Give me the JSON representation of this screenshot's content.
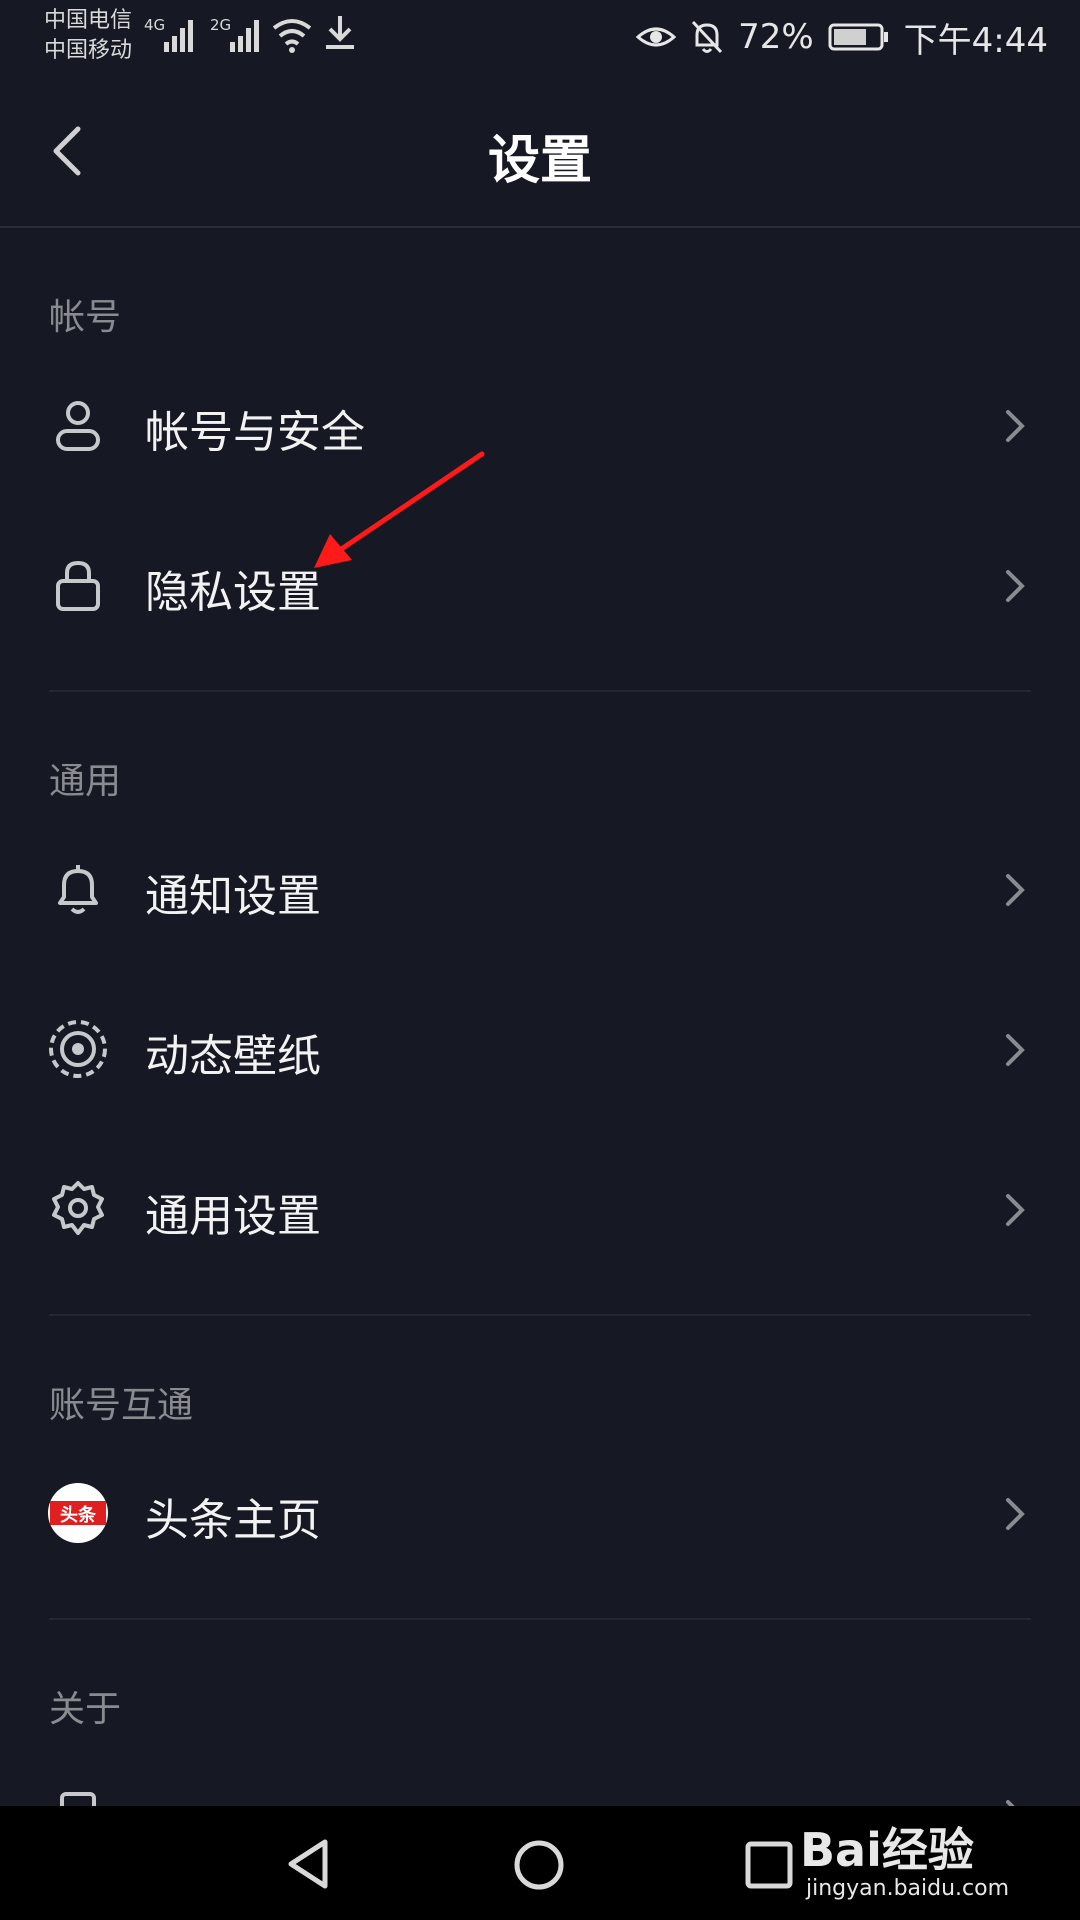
{
  "status_bar": {
    "carrier1": "中国电信",
    "carrier2": "中国移动",
    "net1": "4G",
    "net2": "2G",
    "battery": "72%",
    "time": "下午4:44"
  },
  "header": {
    "title": "设置"
  },
  "sections": {
    "account": {
      "label": "帐号",
      "items": [
        {
          "label": "帐号与安全",
          "icon": "person-icon"
        },
        {
          "label": "隐私设置",
          "icon": "lock-icon"
        }
      ]
    },
    "general": {
      "label": "通用",
      "items": [
        {
          "label": "通知设置",
          "icon": "bell-icon"
        },
        {
          "label": "动态壁纸",
          "icon": "wallpaper-icon"
        },
        {
          "label": "通用设置",
          "icon": "gear-icon"
        }
      ]
    },
    "linked": {
      "label": "账号互通",
      "items": [
        {
          "label": "头条主页",
          "icon": "toutiao-logo",
          "logo_text": "头条"
        }
      ]
    },
    "about": {
      "label": "关于"
    }
  },
  "watermark": {
    "logo": "Bai经验",
    "url": "jingyan.baidu.com"
  },
  "colors": {
    "background": "#161823",
    "toutiao_red": "#e02020",
    "annotation_arrow": "#ff1a1a"
  }
}
